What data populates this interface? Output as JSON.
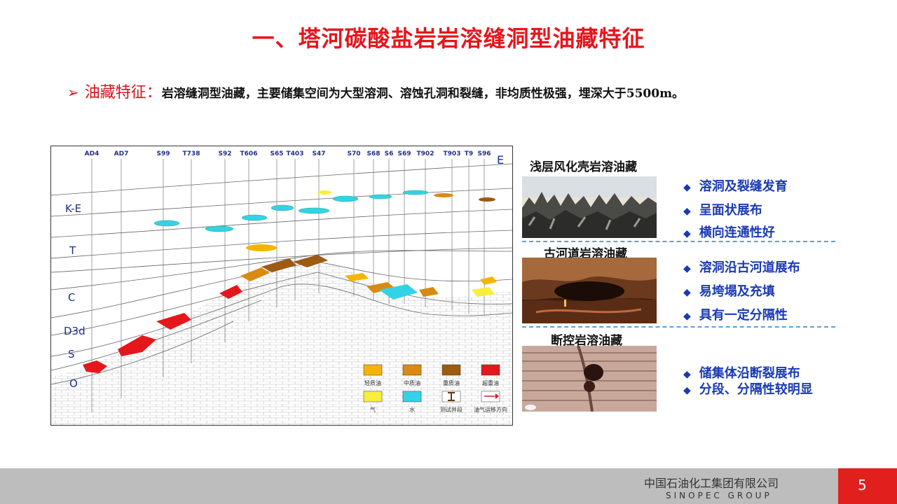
{
  "title": "一、塔河碳酸盐岩岩溶缝洞型油藏特征",
  "feature": {
    "arrow": "➢",
    "label": "油藏特征：",
    "text": "岩溶缝洞型油藏，主要储集空间为大型溶洞、溶蚀孔洞和裂缝，非均质性极强，埋深大于5500m。"
  },
  "diagram": {
    "wells": [
      "AD4",
      "AD7",
      "S99",
      "T738",
      "S92",
      "T606",
      "S65",
      "T403",
      "S47",
      "S70",
      "S68",
      "S6",
      "S69",
      "T902",
      "T903",
      "T9",
      "S96"
    ],
    "direction": "E",
    "strata": [
      "K-E",
      "T",
      "C",
      "D3d",
      "S",
      "O"
    ],
    "legend": [
      {
        "label": "轻质油",
        "color": "#f5b400"
      },
      {
        "label": "中质油",
        "color": "#d98a12"
      },
      {
        "label": "重质油",
        "color": "#9c5a12"
      },
      {
        "label": "超重油",
        "color": "#e5171c"
      },
      {
        "label": "气",
        "color": "#f7ef3c"
      },
      {
        "label": "水",
        "color": "#34d2e6"
      },
      {
        "label": "测试井段",
        "icon": "test-interval-icon"
      },
      {
        "label": "油气运移方向",
        "icon": "migration-arrow-icon"
      }
    ]
  },
  "sections": [
    {
      "title": "浅层风化壳岩溶油藏",
      "bullets": [
        "溶洞及裂缝发育",
        "呈面状展布",
        "横向连通性好"
      ]
    },
    {
      "title": "古河道岩溶油藏",
      "bullets": [
        "溶洞沿古河道展布",
        "易垮塌及充填",
        "具有一定分隔性"
      ]
    },
    {
      "title": "断控岩溶油藏",
      "bullets": [
        "储集体沿断裂展布",
        "分段、分隔性较明显"
      ]
    }
  ],
  "bullet_symbol": "◆",
  "footer": {
    "company_cn": "中国石油化工集团有限公司",
    "company_en": "SINOPEC GROUP",
    "page": "5"
  }
}
